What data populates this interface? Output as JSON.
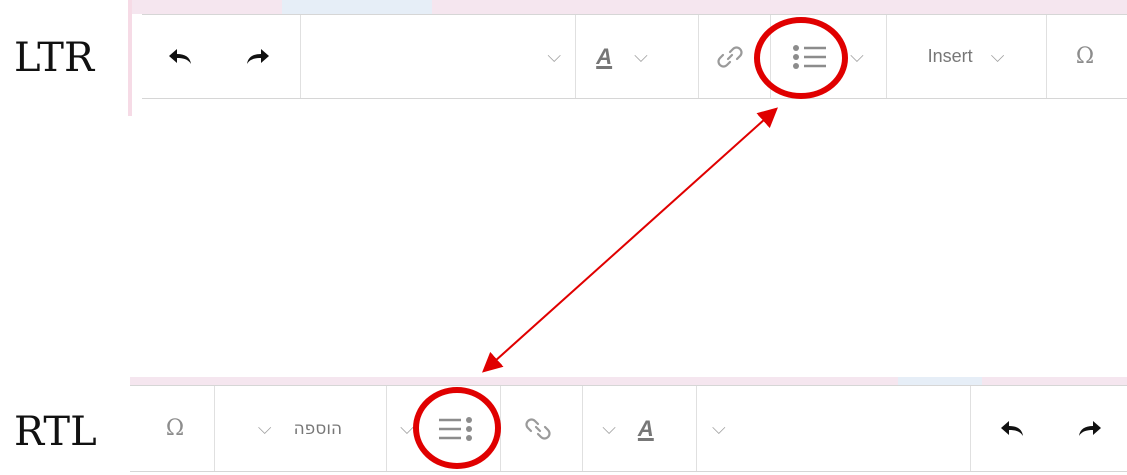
{
  "labels": {
    "ltr": "LTR",
    "rtl": "RTL"
  },
  "ltr_toolbar": {
    "insert_label": "Insert",
    "omega": "Ω",
    "font_style": "A"
  },
  "rtl_toolbar": {
    "insert_label": "הוספה",
    "omega": "Ω",
    "font_style": "A"
  },
  "colors": {
    "highlight": "#e00000",
    "arrow": "#e00000",
    "icon": "#8c8c8c",
    "dark_icon": "#111111"
  }
}
